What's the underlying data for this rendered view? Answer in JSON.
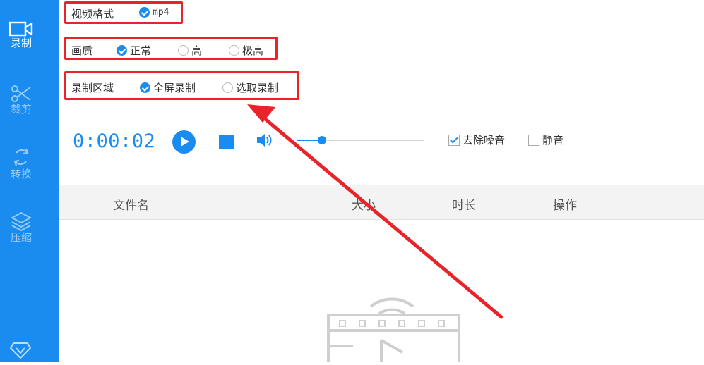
{
  "sidebar": {
    "items": [
      {
        "label": "录制",
        "icon": "video-camera-icon"
      },
      {
        "label": "裁剪",
        "icon": "scissors-icon"
      },
      {
        "label": "转换",
        "icon": "convert-arrows-icon"
      },
      {
        "label": "压缩",
        "icon": "layers-icon"
      }
    ],
    "bottom_icon": "vip-diamond-icon"
  },
  "settings": {
    "format": {
      "label": "视频格式",
      "options": [
        {
          "text": "mp4",
          "checked": true
        }
      ]
    },
    "quality": {
      "label": "画质",
      "options": [
        {
          "text": "正常",
          "checked": true
        },
        {
          "text": "高",
          "checked": false
        },
        {
          "text": "极高",
          "checked": false
        }
      ]
    },
    "area": {
      "label": "录制区域",
      "options": [
        {
          "text": "全屏录制",
          "checked": true
        },
        {
          "text": "选取录制",
          "checked": false
        }
      ]
    }
  },
  "controls": {
    "timer": "0:00:02",
    "volume_level": 0.2,
    "denoise": {
      "label": "去除噪音",
      "checked": true
    },
    "mute": {
      "label": "静音",
      "checked": false
    }
  },
  "table": {
    "headers": [
      "文件名",
      "大小",
      "时长",
      "操作"
    ]
  },
  "colors": {
    "accent": "#1a8cf0",
    "highlight": "#e8232a"
  }
}
